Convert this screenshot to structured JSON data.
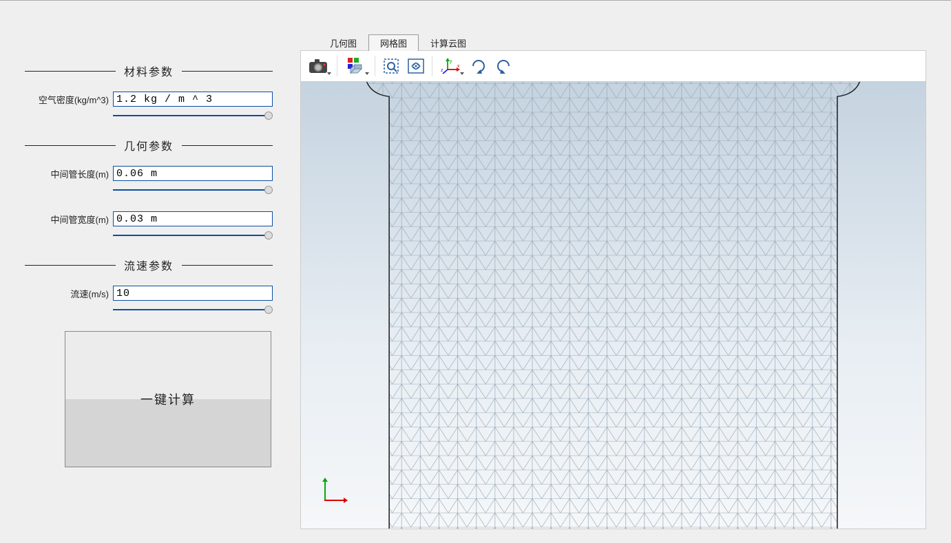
{
  "sidebar": {
    "sections": {
      "material": {
        "title": "材料参数",
        "air_density_label": "空气密度(kg/m^3)",
        "air_density_value": "1.2 kg / m ^ 3"
      },
      "geometry": {
        "title": "几何参数",
        "pipe_length_label": "中间管长度(m)",
        "pipe_length_value": "0.06 m",
        "pipe_width_label": "中间管宽度(m)",
        "pipe_width_value": "0.03 m"
      },
      "velocity": {
        "title": "流速参数",
        "velocity_label": "流速(m/s)",
        "velocity_value": "10"
      }
    },
    "calc_button_label": "一键计算"
  },
  "tabs": {
    "geometry": "几何图",
    "mesh": "网格图",
    "cloud": "计算云图",
    "active": "mesh"
  },
  "toolbar": {
    "snapshot": "snapshot-icon",
    "cube": "graphics-options-icon",
    "zoom_box": "zoom-box-icon",
    "zoom_extents": "zoom-extents-icon",
    "axes": "axes-orientation-icon",
    "rotate_cw": "rotate-cw-icon",
    "rotate_ccw": "rotate-ccw-icon",
    "axes_labels": {
      "x": "x",
      "y": "y",
      "z": "z"
    }
  }
}
